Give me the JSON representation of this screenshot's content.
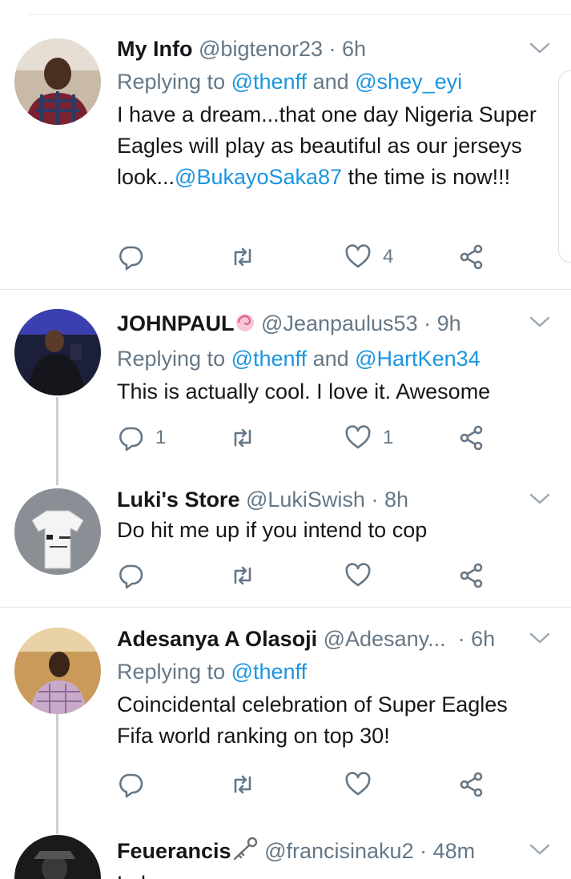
{
  "tweets": [
    {
      "name": "My Info",
      "handle": "@bigtenor23",
      "time": "· 6h",
      "reply_prefix": "Replying to ",
      "reply_a": "@thenff",
      "reply_and": " and ",
      "reply_b": "@shey_eyi",
      "text_1": "I have a dream...that one day Nigeria Super Eagles will play as beautiful as our jerseys look...",
      "mention": "@BukayoSaka87",
      "text_2": " the time is now!!!",
      "likes": "4"
    },
    {
      "name": "JOHNPAUL",
      "handle": "@Jeanpaulus53",
      "time": "· 9h",
      "reply_prefix": "Replying to ",
      "reply_a": "@thenff",
      "reply_and": " and ",
      "reply_b": "@HartKen34",
      "text": "This is actually cool.  I love it.  Awesome",
      "replies": "1",
      "likes": "1"
    },
    {
      "name": "Luki's Store",
      "handle": "@LukiSwish",
      "time": "· 8h",
      "text": "Do hit me up if you intend to cop"
    },
    {
      "name": "Adesanya A Olasoji",
      "handle": "@Adesany...",
      "time": "· 6h",
      "reply_prefix": "Replying to ",
      "reply_a": "@thenff",
      "text": "Coincidental celebration of Super Eagles Fifa world ranking on top 30!"
    },
    {
      "name": "Feuerancis",
      "handle": "@francisinaku2",
      "time": "· 48m",
      "text": "Lol"
    }
  ],
  "colors": {
    "link": "#1b95e0",
    "muted": "#657786",
    "text": "#14171a",
    "divider": "#e1e8ed"
  },
  "icons": [
    "reply-icon",
    "retweet-icon",
    "like-icon",
    "share-icon",
    "chevron-down-icon",
    "lollipop-emoji",
    "key-emoji"
  ]
}
